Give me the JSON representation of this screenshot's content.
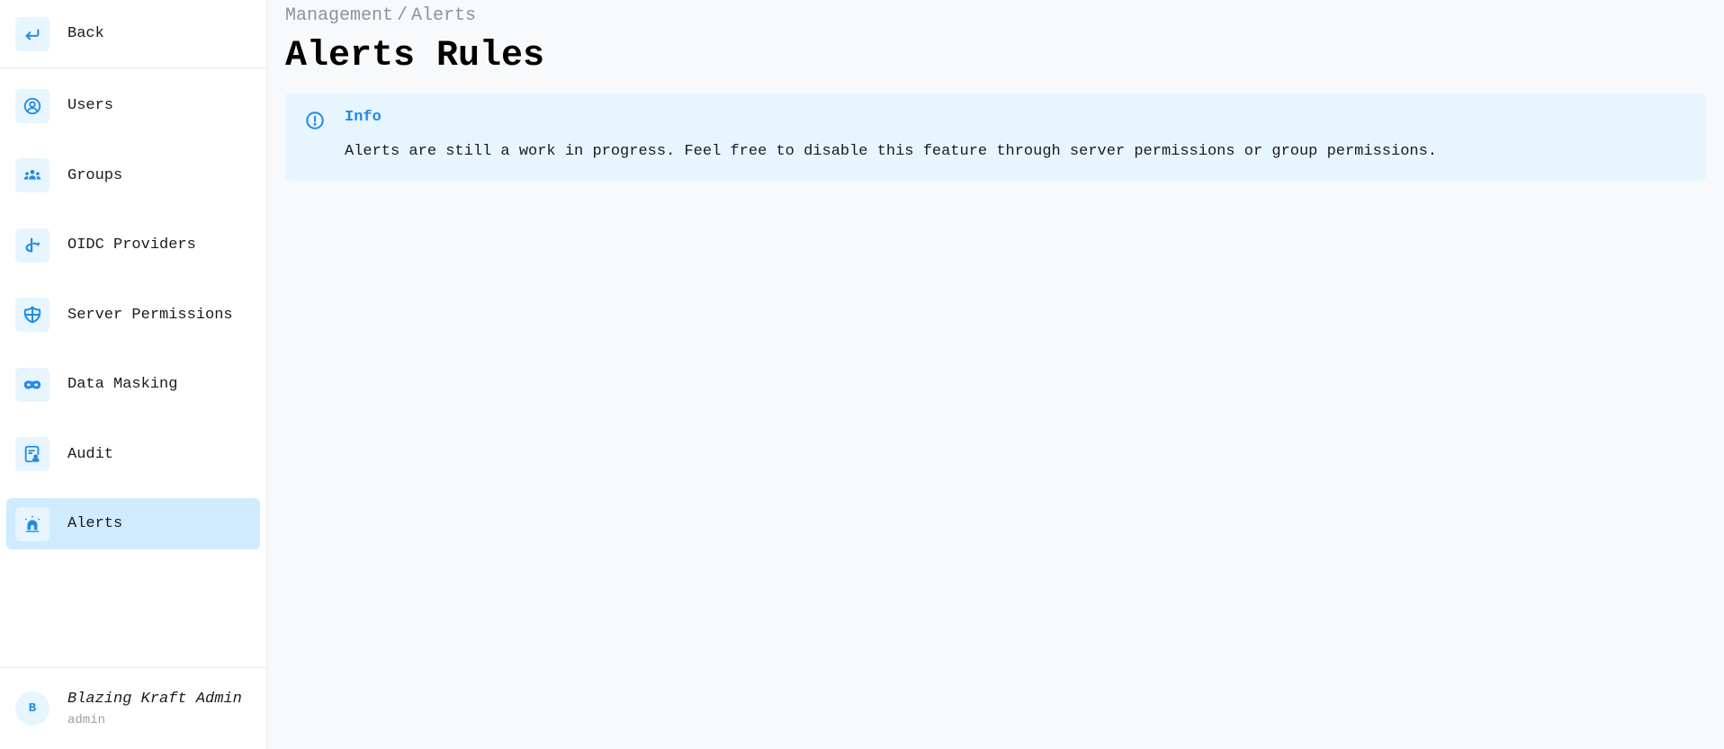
{
  "sidebar": {
    "back": {
      "label": "Back",
      "icon": "arrow-back-icon"
    },
    "items": [
      {
        "label": "Users",
        "icon": "user-circle-icon",
        "active": false
      },
      {
        "label": "Groups",
        "icon": "users-group-icon",
        "active": false
      },
      {
        "label": "OIDC Providers",
        "icon": "openid-icon",
        "active": false
      },
      {
        "label": "Server Permissions",
        "icon": "shield-icon",
        "active": false
      },
      {
        "label": "Data Masking",
        "icon": "mask-icon",
        "active": false
      },
      {
        "label": "Audit",
        "icon": "file-certificate-icon",
        "active": false
      },
      {
        "label": "Alerts",
        "icon": "siren-icon",
        "active": true
      }
    ],
    "user": {
      "initial": "B",
      "name": "Blazing Kraft Admin",
      "role": "admin"
    }
  },
  "header": {
    "breadcrumb": [
      "Management",
      "Alerts"
    ],
    "breadcrumb_separator": "/",
    "title": "Alerts Rules"
  },
  "alert": {
    "icon": "info-circle-icon",
    "title": "Info",
    "message": "Alerts are still a work in progress. Feel free to disable this feature through server permissions or group permissions."
  },
  "colors": {
    "accent": "#228be6",
    "accent_light": "#e7f5ff",
    "active_bg": "#d0ebff",
    "page_bg": "#f8f9fb"
  }
}
